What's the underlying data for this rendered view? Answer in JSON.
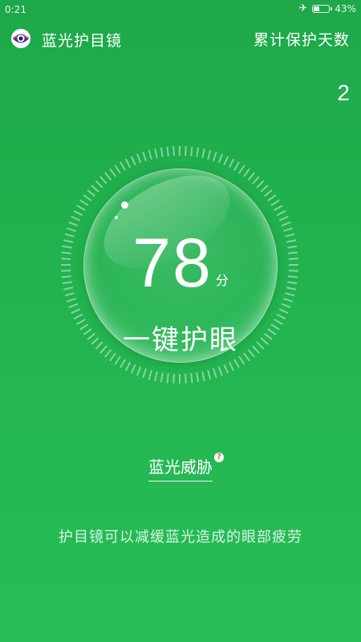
{
  "status_bar": {
    "time": "0:21",
    "battery_text": "43%",
    "battery_level": 0.43,
    "icons": [
      "airplane-icon",
      "battery-icon"
    ]
  },
  "header": {
    "app_title": "蓝光护目镜",
    "days_label": "累计保护天数",
    "days_value": "2",
    "logo_icon": "eye-icon"
  },
  "score": {
    "value": "78",
    "unit": "分",
    "action_label": "一键护眼"
  },
  "threat": {
    "label": "蓝光威胁",
    "help_badge": "?"
  },
  "footer": {
    "tip": "护目镜可以减缓蓝光造成的眼部疲劳"
  },
  "colors": {
    "background": "#22b350",
    "text": "#ffffff",
    "help_badge": "#e7683e"
  }
}
